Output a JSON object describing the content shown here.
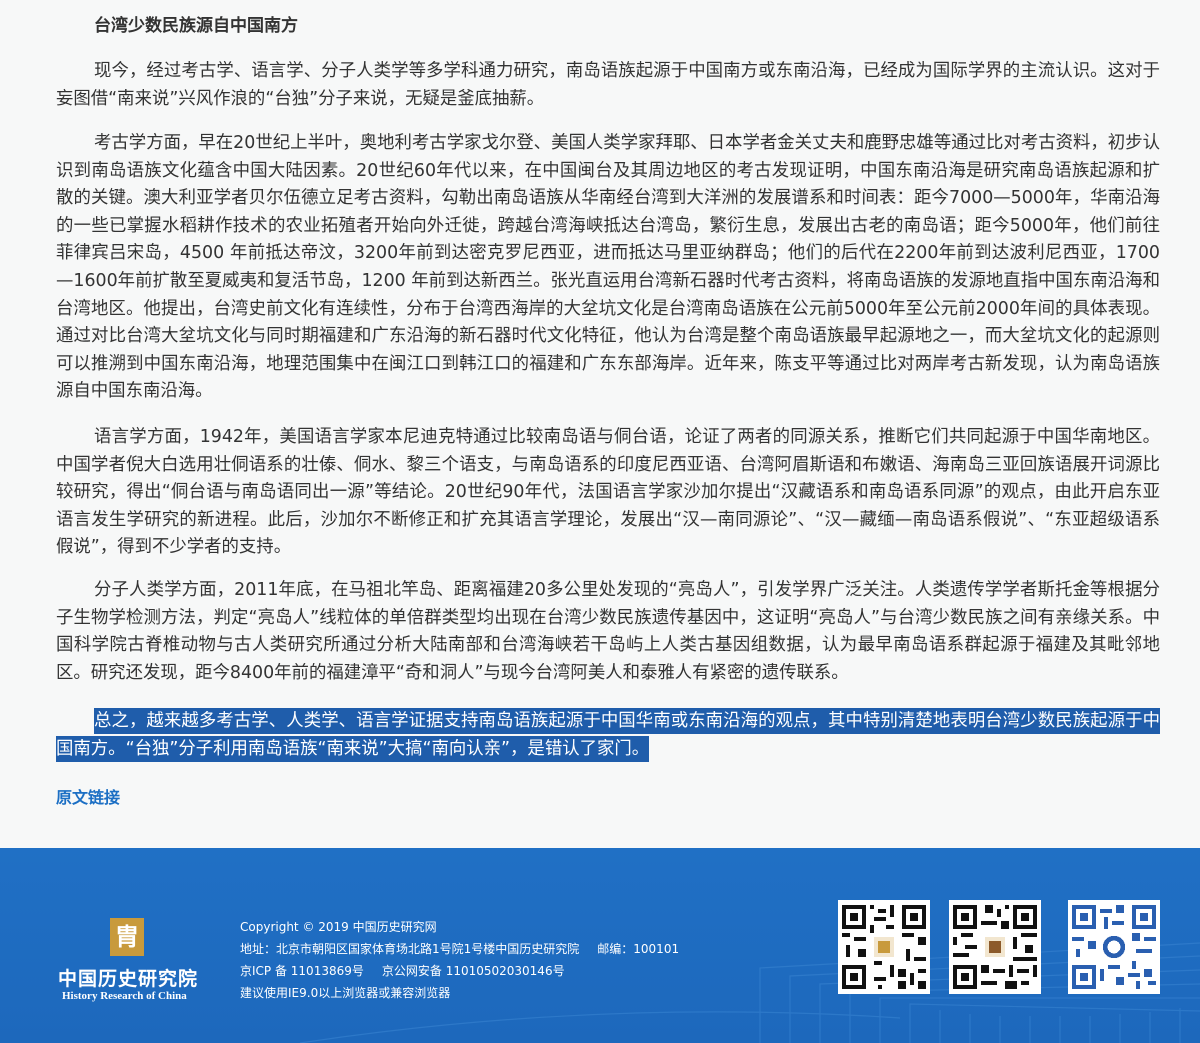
{
  "article": {
    "section_title": "台湾少数民族源自中国南方",
    "paragraphs": [
      "现今，经过考古学、语言学、分子人类学等多学科通力研究，南岛语族起源于中国南方或东南沿海，已经成为国际学界的主流认识。这对于妄图借“南来说”兴风作浪的“台独”分子来说，无疑是釜底抽薪。",
      "考古学方面，早在20世纪上半叶，奥地利考古学家戈尔登、美国人类学家拜耶、日本学者金关丈夫和鹿野忠雄等通过比对考古资料，初步认识到南岛语族文化蕴含中国大陆因素。20世纪60年代以来，在中国闽台及其周边地区的考古发现证明，中国东南沿海是研究南岛语族起源和扩散的关键。澳大利亚学者贝尔伍德立足考古资料，勾勒出南岛语族从华南经台湾到大洋洲的发展谱系和时间表：距今7000—5000年，华南沿海的一些已掌握水稻耕作技术的农业拓殖者开始向外迁徙，跨越台湾海峡抵达台湾岛，繁衍生息，发展出古老的南岛语；距今5000年，他们前往菲律宾吕宋岛，4500 年前抵达帝汶，3200年前到达密克罗尼西亚，进而抵达马里亚纳群岛；他们的后代在2200年前到达波利尼西亚，1700—1600年前扩散至夏威夷和复活节岛，1200 年前到达新西兰。张光直运用台湾新石器时代考古资料，将南岛语族的发源地直指中国东南沿海和台湾地区。他提出，台湾史前文化有连续性，分布于台湾西海岸的大坌坑文化是台湾南岛语族在公元前5000年至公元前2000年间的具体表现。通过对比台湾大坌坑文化与同时期福建和广东沿海的新石器时代文化特征，他认为台湾是整个南岛语族最早起源地之一，而大坌坑文化的起源则可以推溯到中国东南沿海，地理范围集中在闽江口到韩江口的福建和广东东部海岸。近年来，陈支平等通过比对两岸考古新发现，认为南岛语族源自中国东南沿海。",
      "语言学方面，1942年，美国语言学家本尼迪克特通过比较南岛语与侗台语，论证了两者的同源关系，推断它们共同起源于中国华南地区。中国学者倪大白选用壮侗语系的壮傣、侗水、黎三个语支，与南岛语系的印度尼西亚语、台湾阿眉斯语和布嫩语、海南岛三亚回族语展开词源比较研究，得出“侗台语与南岛语同出一源”等结论。20世纪90年代，法国语言学家沙加尔提出“汉藏语系和南岛语系同源”的观点，由此开启东亚语言发生学研究的新进程。此后，沙加尔不断修正和扩充其语言学理论，发展出“汉—南同源论”、“汉—藏缅—南岛语系假说”、“东亚超级语系假说”，得到不少学者的支持。",
      "分子人类学方面，2011年底，在马祖北竿岛、距离福建20多公里处发现的“亮岛人”，引发学界广泛关注。人类遗传学学者斯托金等根据分子生物学检测方法，判定“亮岛人”线粒体的单倍群类型均出现在台湾少数民族遗传基因中，这证明“亮岛人”与台湾少数民族之间有亲缘关系。中国科学院古脊椎动物与古人类研究所通过分析大陆南部和台湾海峡若干岛屿上人类古基因组数据，认为最早南岛语系群起源于福建及其毗邻地区。研究还发现，距今8400年前的福建漳平“奇和洞人”与现今台湾阿美人和泰雅人有紧密的遗传联系。",
      "总之，越来越多考古学、人类学、语言学证据支持南岛语族起源于中国华南或东南沿海的观点，其中特别清楚地表明台湾少数民族起源于中国南方。“台独”分子利用南岛语族“南来说”大搞“南向认亲”，是错认了家门。"
    ],
    "source_link": "原文链接"
  },
  "footer": {
    "logo_mark": "胄",
    "logo_cn": "中国历史研究院",
    "logo_en": "History Research of China",
    "copyright": "Copyright © 2019 中国历史研究网",
    "address": "地址：北京市朝阳区国家体育场北路1号院1号楼中国历史研究院",
    "postcode": "邮编：100101",
    "icp": "京ICP 备 11013869号",
    "police": "京公网安备 11010502030146号",
    "browser_tip": "建议使用IE9.0以上浏览器或兼容浏览器",
    "qr_codes": [
      "qr-code-1",
      "qr-code-2",
      "qr-code-3"
    ]
  },
  "colors": {
    "page_bg": "#f7f8f8",
    "text": "#333333",
    "selection": "#1f5dab",
    "link": "#1c6fc4",
    "footer_bg": "#1d68bc",
    "logo_gold": "#c89a3c"
  }
}
